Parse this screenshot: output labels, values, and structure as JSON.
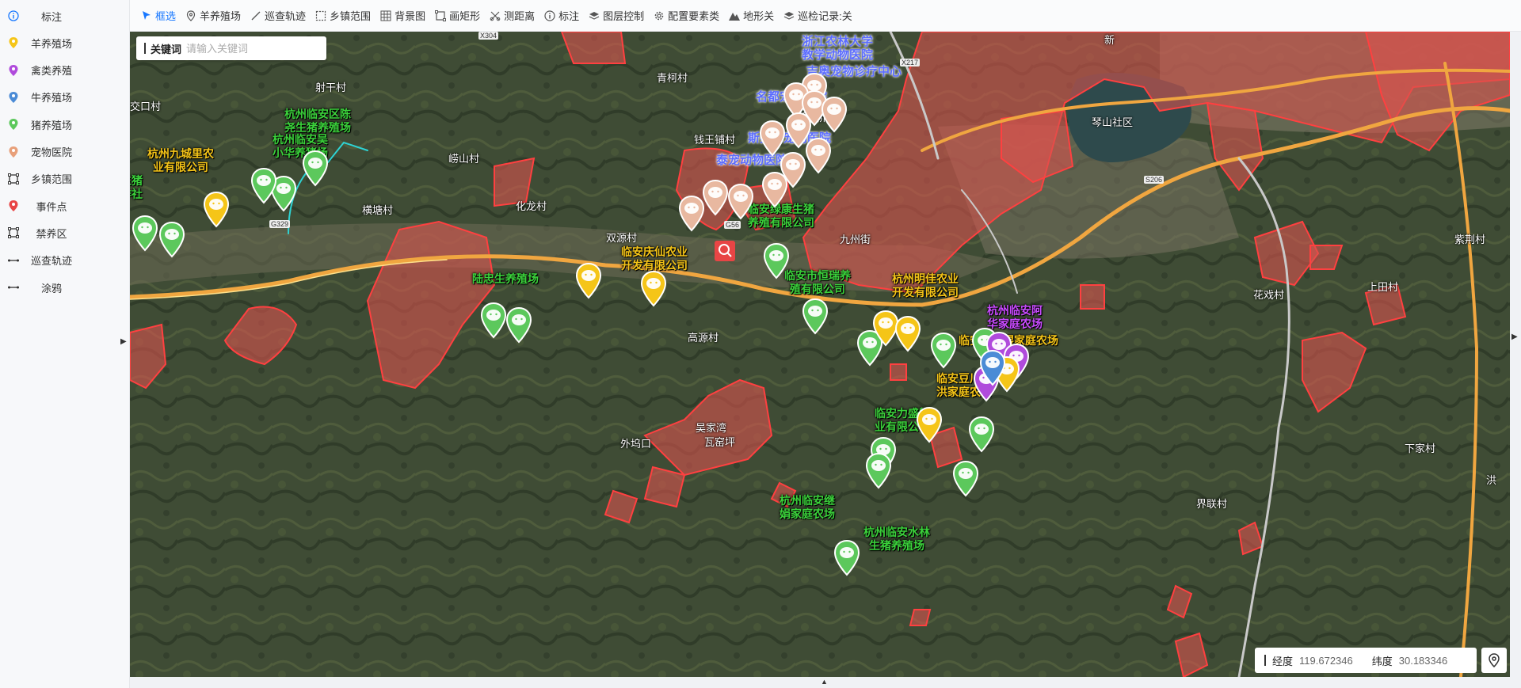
{
  "sidebar": {
    "items": [
      {
        "label": "标注",
        "icon": "info-icon",
        "color": "#1677ff"
      },
      {
        "label": "羊养殖场",
        "icon": "pin-icon",
        "color": "#f5c518"
      },
      {
        "label": "禽类养殖",
        "icon": "pin-icon",
        "color": "#b04bdc"
      },
      {
        "label": "牛养殖场",
        "icon": "pin-icon",
        "color": "#4b8bd6"
      },
      {
        "label": "猪养殖场",
        "icon": "pin-icon",
        "color": "#5cc85c"
      },
      {
        "label": "宠物医院",
        "icon": "pin-icon",
        "color": "#e8a07a"
      },
      {
        "label": "乡镇范围",
        "icon": "rectangle-icon",
        "color": "#333333"
      },
      {
        "label": "事件点",
        "icon": "pin-icon",
        "color": "#e84545"
      },
      {
        "label": "禁养区",
        "icon": "rectangle-icon",
        "color": "#333333"
      },
      {
        "label": "巡查轨迹",
        "icon": "dots-line-icon",
        "color": "#333333"
      },
      {
        "label": "涂鸦",
        "icon": "dots-line-icon",
        "color": "#333333"
      }
    ]
  },
  "toolbar": {
    "items": [
      {
        "label": "框选",
        "icon": "select-arrow-icon",
        "active": true
      },
      {
        "label": "羊养殖场",
        "icon": "location-pin-icon",
        "active": false
      },
      {
        "label": "巡查轨迹",
        "icon": "line-icon",
        "active": false
      },
      {
        "label": "乡镇范围",
        "icon": "dashed-rect-icon",
        "active": false
      },
      {
        "label": "背景图",
        "icon": "grid-icon",
        "active": false
      },
      {
        "label": "画矩形",
        "icon": "rect-draw-icon",
        "active": false
      },
      {
        "label": "测距离",
        "icon": "ruler-icon",
        "active": false
      },
      {
        "label": "标注",
        "icon": "info-icon",
        "active": false
      },
      {
        "label": "图层控制",
        "icon": "layers-icon",
        "active": false
      },
      {
        "label": "配置要素类",
        "icon": "gear-icon",
        "active": false
      },
      {
        "label": "地形关",
        "icon": "mountain-icon",
        "active": false
      },
      {
        "label": "巡检记录:关",
        "icon": "layers-icon",
        "active": false
      }
    ]
  },
  "search": {
    "key_label": "关键词",
    "placeholder": "请输入关键词"
  },
  "coords": {
    "lng_label": "经度",
    "lng_value": "119.672346",
    "lat_label": "纬度",
    "lat_value": "30.183346"
  },
  "map": {
    "place_labels": [
      "射干村",
      "交口村",
      "青柯村",
      "新溪桥村",
      "钱王铺村",
      "崂山村",
      "横塘村",
      "化龙村",
      "双源村",
      "高源村",
      "外坞口",
      "瓦窑坪",
      "吴家湾",
      "九州街",
      "琴山社区",
      "花戏村",
      "上田村",
      "界联村",
      "下家村",
      "紫荆村",
      "洪",
      "新",
      "X304",
      "X217",
      "G329",
      "G56",
      "S206"
    ],
    "poi_labels": [
      {
        "text": "杭州临安区陈\n尧生猪养殖场",
        "color": "green"
      },
      {
        "text": "杭州临安吴\n小华养猪场",
        "color": "green"
      },
      {
        "text": "杭州九城里农\n业有限公司",
        "color": "yellow"
      },
      {
        "text": "生猪\n作社",
        "color": "green"
      },
      {
        "text": "浙江农林大学\n教学动物医院",
        "color": "blue"
      },
      {
        "text": "吉奥宠物诊疗中心",
        "color": "blue"
      },
      {
        "text": "名都宠物医院",
        "color": "blue"
      },
      {
        "text": "斯曼尔宠物医院",
        "color": "blue"
      },
      {
        "text": "泰宠动物医院",
        "color": "blue"
      },
      {
        "text": "临安绿康生猪\n养殖有限公司",
        "color": "green"
      },
      {
        "text": "临安庆仙农业\n开发有限公司",
        "color": "yellow"
      },
      {
        "text": "陆忠生养殖场",
        "color": "green"
      },
      {
        "text": "临安市恒瑞养\n殖有限公司",
        "color": "green"
      },
      {
        "text": "杭州明佳农业\n开发有限公司",
        "color": "yellow"
      },
      {
        "text": "杭州临安阿\n华家庭农场",
        "color": "purple"
      },
      {
        "text": "临安王相煜家庭农场",
        "color": "yellow"
      },
      {
        "text": "临安豆川程\n洪家庭农场",
        "color": "yellow"
      },
      {
        "text": "临安力盛牧\n业有限公司",
        "color": "green"
      },
      {
        "text": "杭州临安继\n娟家庭农场",
        "color": "green"
      },
      {
        "text": "杭州临安水林\n生猪养殖场",
        "color": "green"
      }
    ]
  },
  "colors": {
    "restricted_zone": "#d9534f",
    "road": "#f0a640",
    "accent": "#1677ff"
  }
}
